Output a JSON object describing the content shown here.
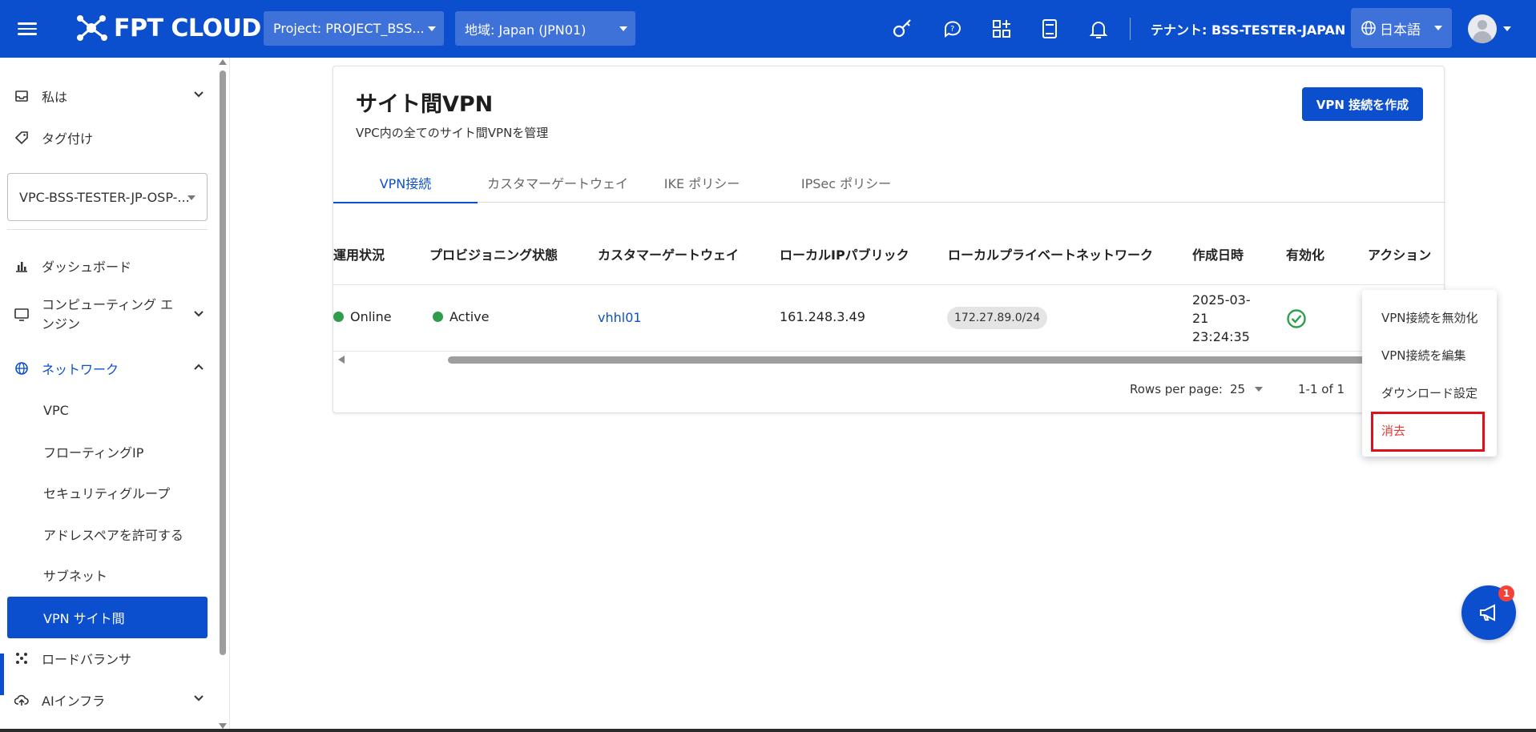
{
  "header": {
    "brand": "FPT CLOUD",
    "project_select": "Project: PROJECT_BSS...",
    "region_select": "地域: Japan (JPN01)",
    "tenant": "テナント: BSS-TESTER-JAPAN",
    "language": "日本語",
    "icons": [
      "key-icon",
      "support-chat-icon",
      "apps-add-icon",
      "calculator-icon",
      "bell-icon"
    ]
  },
  "sidebar": {
    "top_items": [
      {
        "label": "私は",
        "icon": "inbox-icon",
        "expandable": true
      },
      {
        "label": "タグ付け",
        "icon": "tag-icon",
        "expandable": false
      }
    ],
    "vpc_select": "VPC-BSS-TESTER-JP-OSP-...",
    "items": [
      {
        "label": "ダッシュボード",
        "icon": "bar-chart-icon"
      },
      {
        "label": "コンピューティング エンジン",
        "icon": "monitor-icon"
      },
      {
        "label": "ネットワーク",
        "icon": "globe-icon"
      }
    ],
    "network_sub": [
      "VPC",
      "フローティングIP",
      "セキュリティグループ",
      "アドレスペアを許可する",
      "サブネット",
      "VPN サイト間"
    ],
    "bottom_items": [
      {
        "label": "ロードバランサ",
        "icon": "load-balancer-icon"
      },
      {
        "label": "AIインフラ",
        "icon": "cloud-upload-icon"
      }
    ]
  },
  "main": {
    "title": "サイト間VPN",
    "subtitle": "VPC内の全てのサイト間VPNを管理",
    "create_button": "VPN 接続を作成",
    "tabs": [
      "VPN接続",
      "カスタマーゲートウェイ",
      "IKE ポリシー",
      "IPSec ポリシー"
    ],
    "active_tab": 0,
    "columns": [
      "運用状況",
      "プロビジョニング状態",
      "カスタマーゲートウェイ",
      "ローカルIPパブリック",
      "ローカルプライベートネットワーク",
      "作成日時",
      "有効化",
      "アクション"
    ],
    "rows": [
      {
        "operation_status": "Online",
        "provisioning_status": "Active",
        "customer_gateway": "vhhl01",
        "local_ip_public": "161.248.3.49",
        "local_private_network": "172.27.89.0/24",
        "created_line1": "2025-03-",
        "created_line2": "21",
        "created_line3": "23:24:35",
        "enabled": true
      }
    ],
    "rows_per_page_label": "Rows per page:",
    "rows_per_page": "25",
    "range": "1-1 of 1"
  },
  "action_menu": {
    "items": [
      "VPN接続を無効化",
      "VPN接続を編集",
      "ダウンロード設定",
      "消去"
    ]
  },
  "fab": {
    "badge": "1"
  },
  "colors": {
    "primary": "#0b4fcf",
    "success": "#2e9e4c",
    "danger": "#e53935"
  }
}
